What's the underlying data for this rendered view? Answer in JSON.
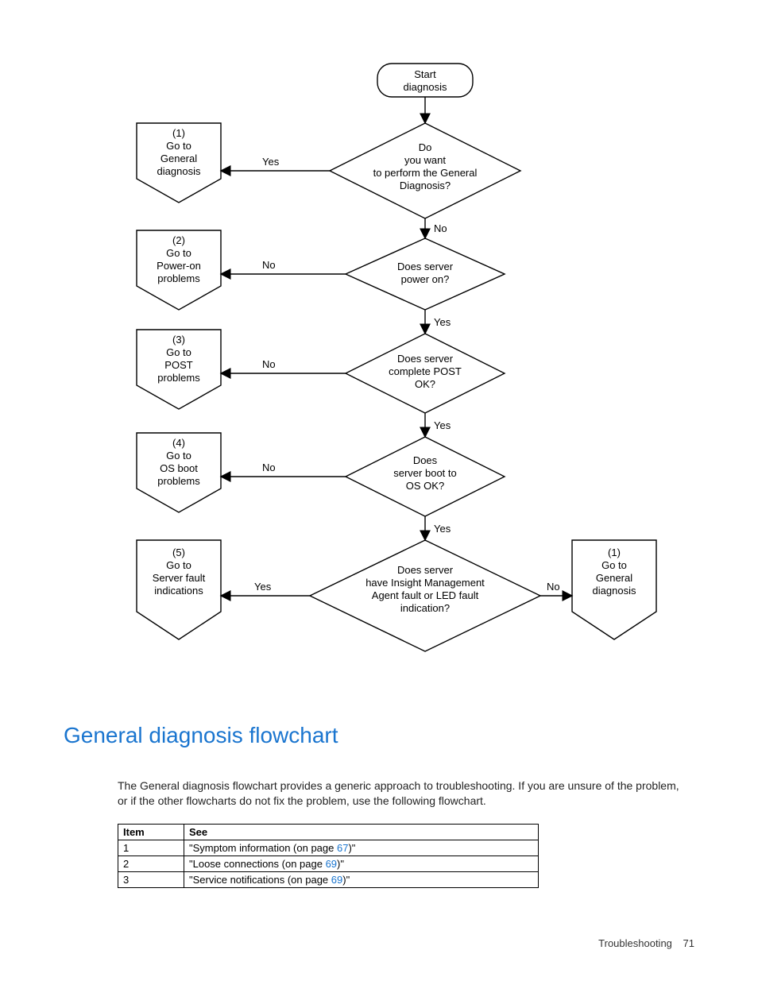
{
  "flowchart": {
    "start": "Start\ndiagnosis",
    "d1": "Do\nyou want\nto perform the General\nDiagnosis?",
    "d2": "Does server\npower on?",
    "d3": "Does server\ncomplete POST\nOK?",
    "d4": "Does\nserver boot to\nOS OK?",
    "d5": "Does server\nhave Insight Management\nAgent fault or LED fault\nindication?",
    "r1": "(1)\nGo to\nGeneral\ndiagnosis",
    "r2": "(2)\nGo to\nPower-on\nproblems",
    "r3": "(3)\nGo to\nPOST\nproblems",
    "r4": "(4)\nGo to\nOS boot\nproblems",
    "r5": "(5)\nGo to\nServer fault\nindications",
    "r1b": "(1)\nGo to\nGeneral\ndiagnosis",
    "yes": "Yes",
    "no": "No"
  },
  "heading": "General diagnosis flowchart",
  "description": "The General diagnosis flowchart provides a generic approach to troubleshooting. If you are unsure of the problem, or if the other flowcharts do not fix the problem, use the following flowchart.",
  "table": {
    "head": {
      "c1": "Item",
      "c2": "See"
    },
    "rows": [
      {
        "item": "1",
        "pre": "\"Symptom information (on page ",
        "link": "67",
        "post": ")\""
      },
      {
        "item": "2",
        "pre": "\"Loose connections (on page ",
        "link": "69",
        "post": ")\""
      },
      {
        "item": "3",
        "pre": "\"Service notifications (on page ",
        "link": "69",
        "post": ")\""
      }
    ]
  },
  "footer": {
    "section": "Troubleshooting",
    "page": "71"
  }
}
